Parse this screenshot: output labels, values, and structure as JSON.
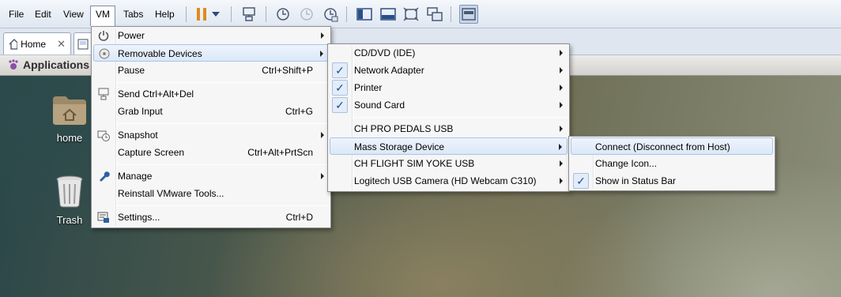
{
  "menubar": {
    "items": [
      {
        "label": "File"
      },
      {
        "label": "Edit"
      },
      {
        "label": "View"
      },
      {
        "label": "VM"
      },
      {
        "label": "Tabs"
      },
      {
        "label": "Help"
      }
    ]
  },
  "toolbar": {
    "icons": [
      "pause-icon",
      "dropdown-arrow-icon",
      "send-ctrl-alt-del-icon",
      "snapshot-take-icon",
      "snapshot-revert-icon",
      "snapshot-manager-icon",
      "sidebar-view-icon",
      "console-view-icon",
      "fullscreen-icon",
      "unity-icon",
      "thumbnail-view-icon"
    ]
  },
  "tabs": [
    {
      "label": "Home"
    }
  ],
  "guest": {
    "panel_label": "Applications",
    "desktop_icons": [
      {
        "label": "home"
      },
      {
        "label": "Trash"
      }
    ]
  },
  "vm_menu": {
    "items": [
      {
        "label": "Power",
        "shortcut": "",
        "icon": "power-icon"
      },
      {
        "label": "Removable Devices",
        "shortcut": "",
        "icon": "removable-devices-icon"
      },
      {
        "label": "Pause",
        "shortcut": "Ctrl+Shift+P",
        "icon": ""
      },
      {
        "label": "Send Ctrl+Alt+Del",
        "shortcut": "",
        "icon": "send-ctrl-alt-del-icon"
      },
      {
        "label": "Grab Input",
        "shortcut": "Ctrl+G",
        "icon": ""
      },
      {
        "label": "Snapshot",
        "shortcut": "",
        "icon": "snapshot-icon"
      },
      {
        "label": "Capture Screen",
        "shortcut": "Ctrl+Alt+PrtScn",
        "icon": ""
      },
      {
        "label": "Manage",
        "shortcut": "",
        "icon": "wrench-icon"
      },
      {
        "label": "Reinstall VMware Tools...",
        "shortcut": "",
        "icon": ""
      },
      {
        "label": "Settings...",
        "shortcut": "Ctrl+D",
        "icon": "settings-icon"
      }
    ]
  },
  "devices_menu": {
    "items": [
      {
        "label": "CD/DVD (IDE)",
        "checked": false
      },
      {
        "label": "Network Adapter",
        "checked": true
      },
      {
        "label": "Printer",
        "checked": true
      },
      {
        "label": "Sound Card",
        "checked": true
      },
      {
        "label": "CH PRO PEDALS USB",
        "checked": false
      },
      {
        "label": "Mass Storage Device",
        "checked": false
      },
      {
        "label": "CH FLIGHT SIM YOKE USB",
        "checked": false
      },
      {
        "label": "Logitech USB Camera (HD Webcam C310)",
        "checked": false
      }
    ]
  },
  "mass_storage_menu": {
    "items": [
      {
        "label": "Connect (Disconnect from Host)",
        "checked": false
      },
      {
        "label": "Change Icon...",
        "checked": false
      },
      {
        "label": "Show in Status Bar",
        "checked": true
      }
    ]
  },
  "glyphs": {
    "check": "✓",
    "close": "✕"
  },
  "colors": {
    "highlight_border": "#a9c4e8",
    "pause_orange": "#e08a1e",
    "check_blue": "#1d4d97"
  }
}
